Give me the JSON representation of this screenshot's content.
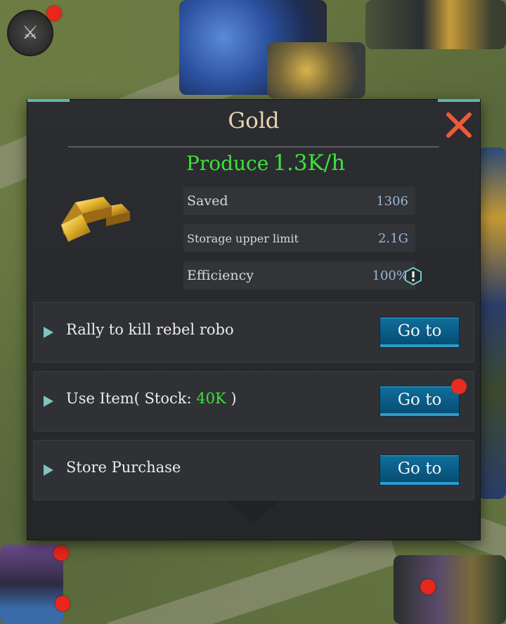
{
  "dialog": {
    "title": "Gold",
    "produce_label": "Produce",
    "produce_value": "1.3K/h",
    "stats": {
      "saved": {
        "label": "Saved",
        "value": "1306"
      },
      "limit": {
        "label": "Storage upper limit",
        "value": "2.1G"
      },
      "efficiency": {
        "label": "Efficiency",
        "value": "100%"
      }
    },
    "sources": [
      {
        "text": "Rally to kill rebel robo",
        "button": "Go to"
      },
      {
        "text_prefix": "Use Item( Stock: ",
        "stock": "40K",
        "text_suffix": " )",
        "button": "Go to",
        "has_notification": true
      },
      {
        "text": "Store Purchase",
        "button": "Go to"
      }
    ]
  },
  "colors": {
    "produce_green": "#3ee23a",
    "stat_value_blue": "#9ab6d6",
    "button_blue": "#0a5a84",
    "close_orange": "#ee5a38",
    "notification_red": "#e8261c"
  },
  "icons": [
    "close-icon",
    "gold-bar-icon",
    "info-icon",
    "expand-arrow-icon"
  ]
}
